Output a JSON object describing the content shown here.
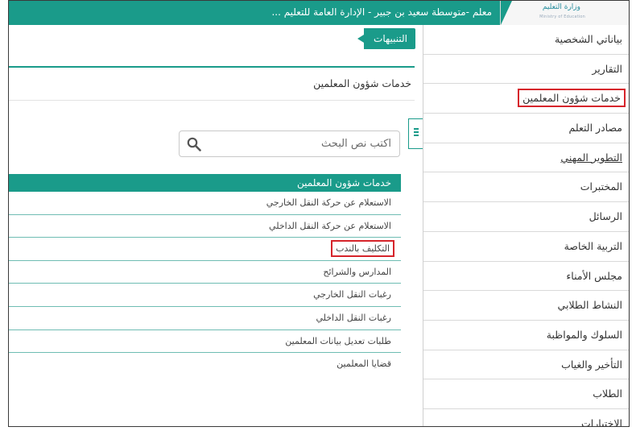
{
  "header": {
    "title": "معلم -متوسطة سعيد بن جبير - الإدارة العامة للتعليم ...",
    "logo_text": "وزارة التعليم",
    "logo_subtext": "Ministry of Education"
  },
  "alerts_tab": {
    "label": "التنبيهات"
  },
  "panel": {
    "title": "خدمات شؤون المعلمين"
  },
  "search": {
    "placeholder": "اكتب نص البحث"
  },
  "services": {
    "header": "خدمات شؤون المعلمين",
    "items": [
      {
        "label": "الاستعلام عن حركة النقل الخارجي"
      },
      {
        "label": "الاستعلام عن حركة النقل الداخلي"
      },
      {
        "label": "التكليف بالندب",
        "highlighted": true
      },
      {
        "label": "المدارس والشرائح"
      },
      {
        "label": "رغبات النقل الخارجي"
      },
      {
        "label": "رغبات النقل الداخلي"
      },
      {
        "label": "طلبات تعديل بيانات المعلمين"
      },
      {
        "label": "قضايا المعلمين"
      }
    ]
  },
  "sidebar": {
    "items": [
      {
        "label": "بياناتي الشخصية"
      },
      {
        "label": "التقارير"
      },
      {
        "label": "خدمات شؤون المعلمين",
        "highlighted": true
      },
      {
        "label": "مصادر التعلم"
      },
      {
        "label": "التطوير المهني",
        "underlined": true
      },
      {
        "label": "المختبرات"
      },
      {
        "label": "الرسائل"
      },
      {
        "label": "التربية الخاصة"
      },
      {
        "label": "مجلس الأمناء"
      },
      {
        "label": "النشاط الطلابي"
      },
      {
        "label": "السلوك والمواظبة"
      },
      {
        "label": "التأخير والغياب"
      },
      {
        "label": "الطلاب"
      },
      {
        "label": "الاختبارات"
      }
    ]
  },
  "colors": {
    "accent": "#1a9b8a",
    "highlight_box": "#d6242b"
  }
}
